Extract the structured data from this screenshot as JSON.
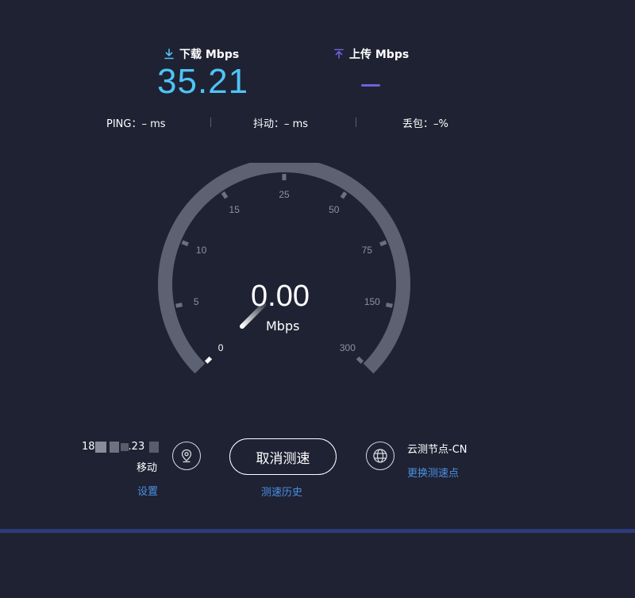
{
  "header": {
    "download": {
      "label": "下载 Mbps",
      "value": "35.21"
    },
    "upload": {
      "label": "上传 Mbps",
      "value": ""
    }
  },
  "stats": {
    "ping": "PING：– ms",
    "jitter": "抖动：– ms",
    "loss": "丢包：–%"
  },
  "gauge": {
    "value": "0.00",
    "unit": "Mbps",
    "ticks": [
      "0",
      "5",
      "10",
      "15",
      "25",
      "50",
      "75",
      "150",
      "300"
    ],
    "needle_level": 0
  },
  "client": {
    "ip_prefix": "18",
    "ip_suffix": ".23",
    "carrier": "移动",
    "settings_label": "设置",
    "location_icon": "location-pin-icon"
  },
  "actions": {
    "cancel_label": "取消测速",
    "history_label": "测速历史"
  },
  "server": {
    "node_name": "云测节点-CN",
    "change_label": "更换测速点",
    "globe_icon": "globe-icon"
  },
  "colors": {
    "background": "#1f2233",
    "download": "#4fc3f7",
    "upload": "#6c63d9",
    "gauge_arc": "#5d6273",
    "link": "#4a90e2"
  }
}
